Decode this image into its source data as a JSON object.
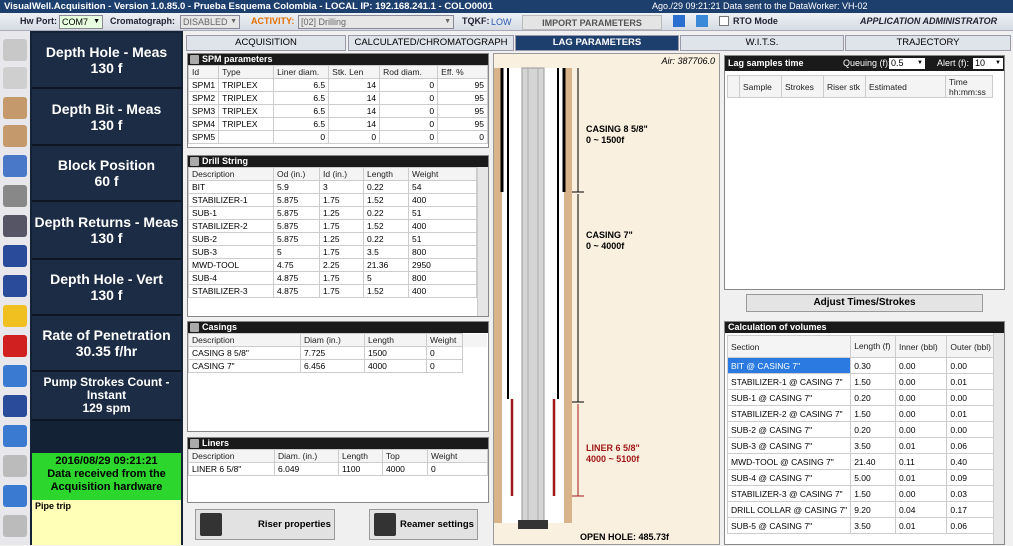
{
  "titlebar": {
    "title": "VisualWell.Acquisition - Version 1.0.85.0 - Prueba Esquema Colombia - LOCAL IP: 192.168.241.1 - COLO0001",
    "right_text": "Ago./29 09:21:21 Data sent to the DataWorker: VH-02"
  },
  "toolbar": {
    "hw_port_label": "Hw Port:",
    "hw_port_value": "COM7",
    "cromatograph_label": "Cromatograph:",
    "cromatograph_value": "DISABLED",
    "activity_label": "ACTIVITY:",
    "activity_value": "[02] Drilling",
    "tqkf_label": "TQKF:",
    "tqkf_value": "LOW",
    "import_label": "IMPORT PARAMETERS",
    "rto_label": "RTO Mode",
    "user_label": "APPLICATION ADMINISTRATOR"
  },
  "left_panel": [
    {
      "label": "Depth Hole - Meas",
      "value": "130 f"
    },
    {
      "label": "Depth Bit - Meas",
      "value": "130 f"
    },
    {
      "label": "Block Position",
      "value": "60 f"
    },
    {
      "label": "Depth Returns - Meas",
      "value": "130 f"
    },
    {
      "label": "Depth Hole - Vert",
      "value": "130 f"
    },
    {
      "label": "Rate of Penetration",
      "value": "30.35 f/hr"
    },
    {
      "label": "Pump Strokes Count - Instant",
      "value": "129 spm"
    }
  ],
  "status": {
    "time": "2016/08/29 09:21:21",
    "message": "Data received from the Acquisition hardware"
  },
  "pipe_trip": "Pipe trip",
  "tabs": [
    "ACQUISITION",
    "CALCULATED/CHROMATOGRAPH",
    "LAG PARAMETERS",
    "W.I.T.S.",
    "TRAJECTORY"
  ],
  "spm": {
    "title": "SPM parameters",
    "headers": [
      "Id",
      "Type",
      "Liner diam.",
      "Stk. Len",
      "Rod diam.",
      "Eff. %"
    ],
    "rows": [
      [
        "SPM1",
        "TRIPLEX",
        "6.5",
        "14",
        "0",
        "95"
      ],
      [
        "SPM2",
        "TRIPLEX",
        "6.5",
        "14",
        "0",
        "95"
      ],
      [
        "SPM3",
        "TRIPLEX",
        "6.5",
        "14",
        "0",
        "95"
      ],
      [
        "SPM4",
        "TRIPLEX",
        "6.5",
        "14",
        "0",
        "95"
      ],
      [
        "SPM5",
        "",
        "0",
        "0",
        "0",
        "0"
      ]
    ]
  },
  "drill_string": {
    "title": "Drill String",
    "headers": [
      "Description",
      "Od (in.)",
      "Id (in.)",
      "Length",
      "Weight"
    ],
    "rows": [
      [
        "BIT",
        "5.9",
        "3",
        "0.22",
        "54"
      ],
      [
        "STABILIZER-1",
        "5.875",
        "1.75",
        "1.52",
        "400"
      ],
      [
        "SUB-1",
        "5.875",
        "1.25",
        "0.22",
        "51"
      ],
      [
        "STABILIZER-2",
        "5.875",
        "1.75",
        "1.52",
        "400"
      ],
      [
        "SUB-2",
        "5.875",
        "1.25",
        "0.22",
        "51"
      ],
      [
        "SUB-3",
        "5",
        "1.75",
        "3.5",
        "800"
      ],
      [
        "MWD-TOOL",
        "4.75",
        "2.25",
        "21.36",
        "2950"
      ],
      [
        "SUB-4",
        "4.875",
        "1.75",
        "5",
        "800"
      ],
      [
        "STABILIZER-3",
        "4.875",
        "1.75",
        "1.52",
        "400"
      ]
    ]
  },
  "casings": {
    "title": "Casings",
    "headers": [
      "Description",
      "Diam (in.)",
      "Length",
      "Weight"
    ],
    "rows": [
      [
        "CASING 8 5/8\"",
        "7.725",
        "1500",
        "0"
      ],
      [
        "CASING 7\"",
        "6.456",
        "4000",
        "0"
      ]
    ]
  },
  "liners": {
    "title": "Liners",
    "headers": [
      "Description",
      "Diam. (in.)",
      "Length",
      "Top",
      "Weight"
    ],
    "rows": [
      [
        "LINER 6 5/8\"",
        "6.049",
        "1100",
        "4000",
        "0"
      ]
    ]
  },
  "buttons": {
    "riser": "Riser properties",
    "reamer": "Reamer settings",
    "adjust": "Adjust Times/Strokes"
  },
  "well": {
    "air": "Air: 387706.0",
    "casing1_name": "CASING 8 5/8\"",
    "casing1_range": "0 ~ 1500f",
    "casing2_name": "CASING 7\"",
    "casing2_range": "0 ~ 4000f",
    "liner_name": "LINER 6 5/8\"",
    "liner_range": "4000 ~ 5100f",
    "open_hole": "OPEN HOLE: 485.73f"
  },
  "lag_samples": {
    "title": "Lag samples time",
    "queuing_label": "Queuing (f):",
    "queuing_value": "0.5",
    "alert_label": "Alert (f):",
    "alert_value": "10",
    "headers": [
      "Sample",
      "Strokes",
      "Riser stk",
      "Estimated",
      "Time hh:mm:ss"
    ]
  },
  "volumes": {
    "title": "Calculation of volumes",
    "headers": [
      "Section",
      "Length (f)",
      "Inner (bbl)",
      "Outer (bbl)"
    ],
    "rows": [
      [
        "BIT @ CASING 7\"",
        "0.30",
        "0.00",
        "0.00"
      ],
      [
        "STABILIZER-1 @ CASING 7\"",
        "1.50",
        "0.00",
        "0.01"
      ],
      [
        "SUB-1 @ CASING 7\"",
        "0.20",
        "0.00",
        "0.00"
      ],
      [
        "STABILIZER-2 @ CASING 7\"",
        "1.50",
        "0.00",
        "0.01"
      ],
      [
        "SUB-2 @ CASING 7\"",
        "0.20",
        "0.00",
        "0.00"
      ],
      [
        "SUB-3 @ CASING 7\"",
        "3.50",
        "0.01",
        "0.06"
      ],
      [
        "MWD-TOOL @ CASING 7\"",
        "21.40",
        "0.11",
        "0.40"
      ],
      [
        "SUB-4 @ CASING 7\"",
        "5.00",
        "0.01",
        "0.09"
      ],
      [
        "STABILIZER-3 @ CASING 7\"",
        "1.50",
        "0.00",
        "0.03"
      ],
      [
        "DRILL COLLAR @ CASING 7\"",
        "9.20",
        "0.04",
        "0.17"
      ],
      [
        "SUB-5 @ CASING 7\"",
        "3.50",
        "0.01",
        "0.06"
      ]
    ]
  },
  "colors": {
    "navy": "#1d3f6e",
    "status_green": "#2dd62d",
    "liner_red": "#a01818"
  }
}
